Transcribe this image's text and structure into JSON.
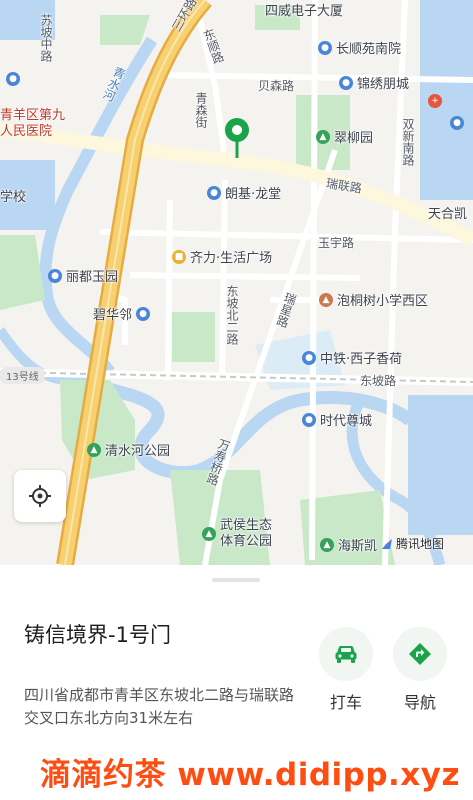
{
  "map": {
    "provider": "腾讯地图",
    "colors": {
      "land": "#f4f3ef",
      "water": "#b9d6f2",
      "park": "#c9e8c8",
      "ring_road": "#f3c45e",
      "road": "#ffffff",
      "pin": "#1ba34a"
    },
    "labels": [
      {
        "text": "四威电子大厦",
        "kind": "place"
      },
      {
        "text": "长顺苑南院",
        "kind": "poi",
        "icon": "building-icon"
      },
      {
        "text": "锦绣朋城",
        "kind": "poi",
        "icon": "building-icon"
      },
      {
        "text": "贝森路",
        "kind": "road"
      },
      {
        "text": "青森街",
        "kind": "road"
      },
      {
        "text": "翠柳园",
        "kind": "poi",
        "icon": "park-icon"
      },
      {
        "text": "双新南路",
        "kind": "road"
      },
      {
        "text": "瑞联路",
        "kind": "road"
      },
      {
        "text": "朗基·龙堂",
        "kind": "poi",
        "icon": "building-icon"
      },
      {
        "text": "天合凯",
        "kind": "place"
      },
      {
        "text": "三环路",
        "kind": "road"
      },
      {
        "text": "东顺路",
        "kind": "road"
      },
      {
        "text": "苏坡中路",
        "kind": "road"
      },
      {
        "text": "青水河",
        "kind": "water"
      },
      {
        "text": "青羊区第九人民医院",
        "kind": "poi",
        "icon": "hospital-icon"
      },
      {
        "text": "学校",
        "kind": "place"
      },
      {
        "text": "玉宇路",
        "kind": "road"
      },
      {
        "text": "齐力·生活广场",
        "kind": "poi",
        "icon": "shopping-icon"
      },
      {
        "text": "丽都玉园",
        "kind": "poi",
        "icon": "building-icon"
      },
      {
        "text": "泡桐树小学西区",
        "kind": "poi",
        "icon": "school-icon"
      },
      {
        "text": "碧华邻",
        "kind": "poi",
        "icon": "building-icon"
      },
      {
        "text": "东坡北二路",
        "kind": "road"
      },
      {
        "text": "瑞星路",
        "kind": "road"
      },
      {
        "text": "中铁·西子香荷",
        "kind": "poi",
        "icon": "building-icon"
      },
      {
        "text": "13号线",
        "kind": "metro"
      },
      {
        "text": "东坡路",
        "kind": "road"
      },
      {
        "text": "时代尊城",
        "kind": "poi",
        "icon": "building-icon"
      },
      {
        "text": "清水河公园",
        "kind": "poi",
        "icon": "park-icon"
      },
      {
        "text": "万寿桥路",
        "kind": "road"
      },
      {
        "text": "武侯生态体育公园",
        "kind": "poi",
        "icon": "park-icon"
      },
      {
        "text": "海斯凯",
        "kind": "poi",
        "icon": "park-icon"
      }
    ]
  },
  "place": {
    "name": "铸信境界-1号门",
    "address": "四川省成都市青羊区东坡北二路与瑞联路交叉口东北方向31米左右"
  },
  "actions": {
    "taxi": {
      "label": "打车",
      "icon": "car-icon",
      "color": "#1ba34a"
    },
    "navigate": {
      "label": "导航",
      "icon": "navigation-icon",
      "color": "#1ba34a"
    }
  },
  "watermark": "滴滴约茶 www.didipp.xyz"
}
